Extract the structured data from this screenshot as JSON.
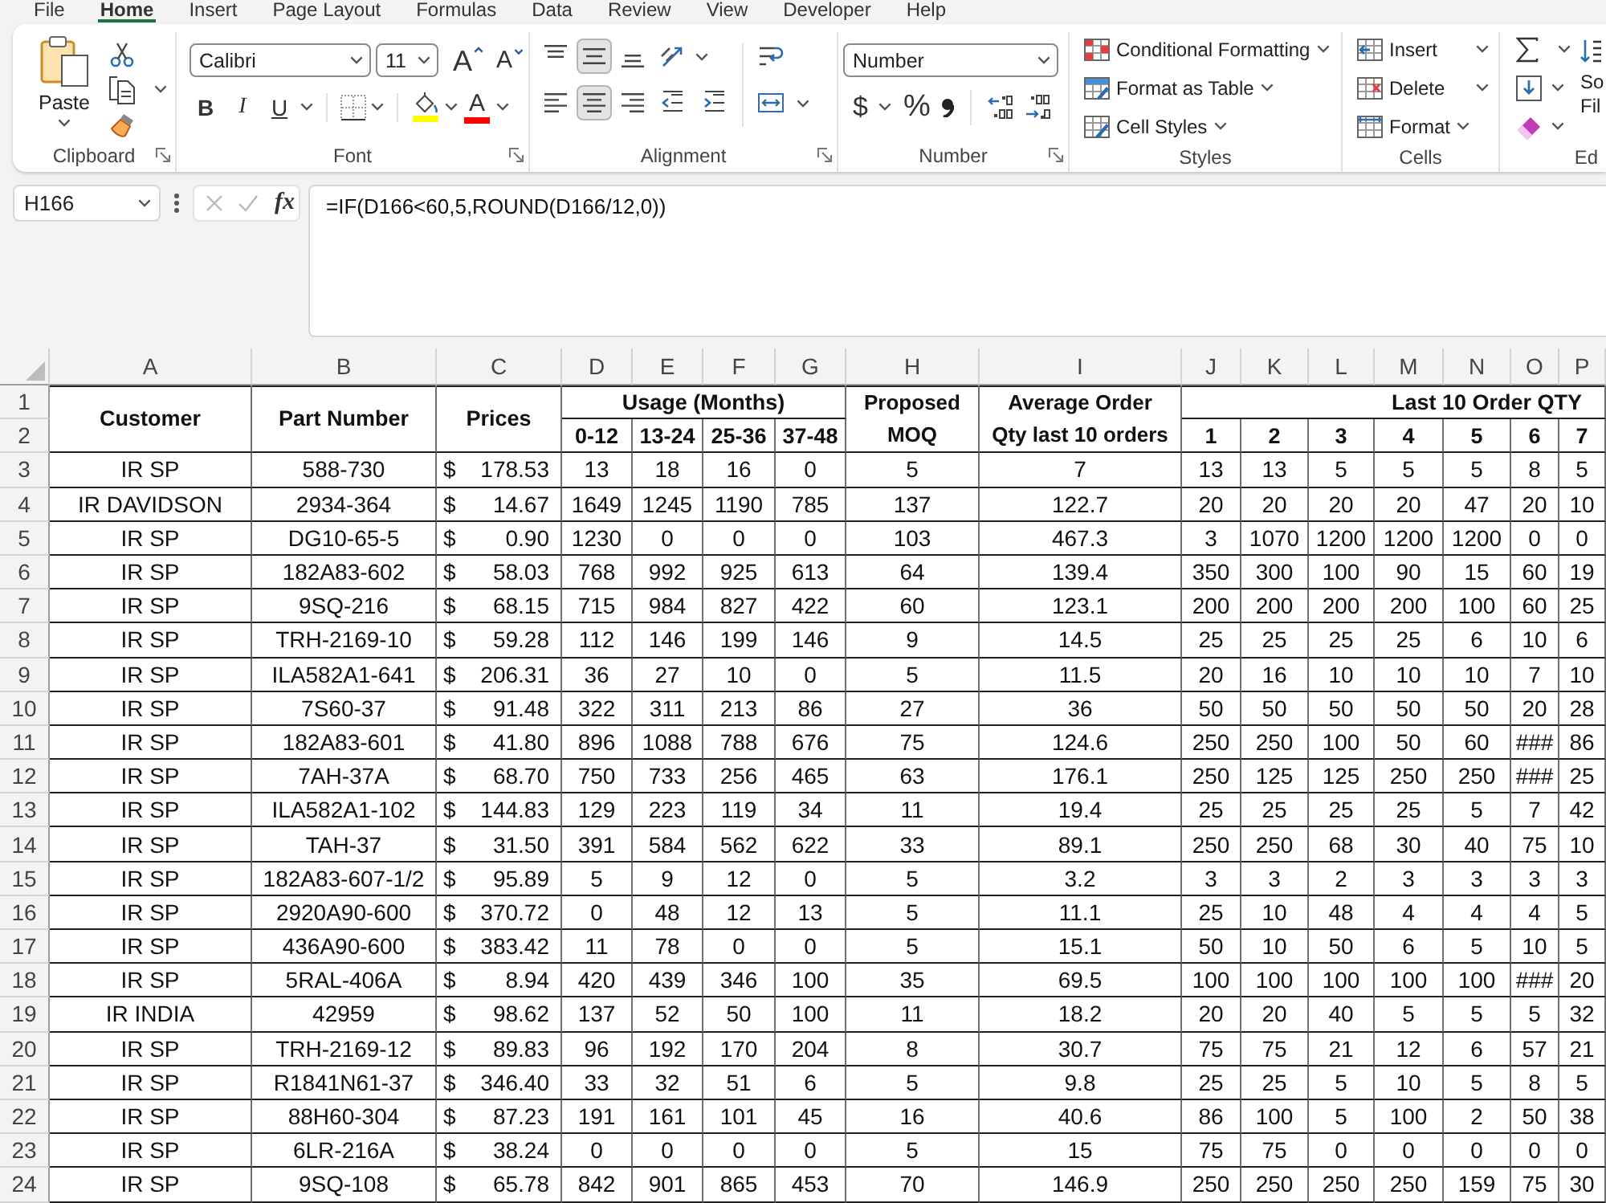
{
  "tabs": [
    {
      "label": "File",
      "selected": false
    },
    {
      "label": "Home",
      "selected": true
    },
    {
      "label": "Insert",
      "selected": false
    },
    {
      "label": "Page Layout",
      "selected": false
    },
    {
      "label": "Formulas",
      "selected": false
    },
    {
      "label": "Data",
      "selected": false
    },
    {
      "label": "Review",
      "selected": false
    },
    {
      "label": "View",
      "selected": false
    },
    {
      "label": "Developer",
      "selected": false
    },
    {
      "label": "Help",
      "selected": false
    }
  ],
  "ribbon": {
    "clipboard": {
      "paste_label": "Paste",
      "group_label": "Clipboard"
    },
    "font": {
      "font_name": "Calibri",
      "font_size": "11",
      "size_buttons": [
        {
          "kind": "grow",
          "label": "A"
        },
        {
          "kind": "shrink",
          "label": "A"
        }
      ],
      "style_buttons": [
        {
          "kind": "bold",
          "label": "B"
        },
        {
          "kind": "italic",
          "label": "I"
        },
        {
          "kind": "underline",
          "label": "U"
        }
      ],
      "color_buttons": [
        {
          "kind": "fill",
          "color": "#ffff00"
        },
        {
          "kind": "text",
          "label": "A",
          "color": "#ff0000"
        }
      ],
      "group_label": "Font"
    },
    "alignment": {
      "vertical": [
        {
          "kind": "top",
          "selected": false
        },
        {
          "kind": "middle",
          "selected": true
        },
        {
          "kind": "bottom",
          "selected": false
        }
      ],
      "horizontal": [
        {
          "kind": "left",
          "selected": false
        },
        {
          "kind": "center",
          "selected": true
        },
        {
          "kind": "right",
          "selected": false
        }
      ],
      "group_label": "Alignment"
    },
    "number": {
      "format": "Number",
      "buttons": [
        {
          "kind": "currency",
          "label": "$"
        },
        {
          "kind": "percent",
          "label": "%"
        }
      ],
      "group_label": "Number"
    },
    "styles": {
      "commands": [
        {
          "kind": "conditional",
          "label": "Conditional Formatting"
        },
        {
          "kind": "table",
          "label": "Format as Table"
        },
        {
          "kind": "cell-styles",
          "label": "Cell Styles"
        }
      ],
      "group_label": "Styles"
    },
    "cells": {
      "commands": [
        {
          "kind": "insert",
          "label": "Insert"
        },
        {
          "kind": "delete",
          "label": "Delete"
        },
        {
          "kind": "format",
          "label": "Format"
        }
      ],
      "group_label": "Cells"
    },
    "editing": {
      "sort_label_lines": [
        "So",
        "Fil"
      ],
      "group_label": "Ed"
    }
  },
  "formula_bar": {
    "name_box": "H166",
    "function_label": "fx",
    "formula": "=IF(D166<60,5,ROUND(D166/12,0))"
  },
  "sheet": {
    "column_letters": [
      "A",
      "B",
      "C",
      "D",
      "E",
      "F",
      "G",
      "H",
      "I",
      "J",
      "K",
      "L",
      "M",
      "N",
      "O",
      "P"
    ],
    "header": {
      "row_numbers": [
        "1",
        "2"
      ],
      "customer": "Customer",
      "part_number": "Part Number",
      "prices": "Prices",
      "usage_title": "Usage (Months)",
      "usage_ranges": [
        "0-12",
        "13-24",
        "25-36",
        "37-48"
      ],
      "proposed_moq": "Proposed MOQ",
      "average_order": "Average Order Qty last 10 orders",
      "last_orders_title": "Last 10 Order QTY",
      "order_numbers": [
        "1",
        "2",
        "3",
        "4",
        "5",
        "6",
        "7"
      ]
    },
    "rows": [
      {
        "row": "3",
        "customer": "IR SP",
        "part_number": "588-730",
        "currency": "$",
        "price": "178.53",
        "usage": [
          "13",
          "18",
          "16",
          "0"
        ],
        "proposed_moq": "5",
        "average_order": "7",
        "orders": [
          "13",
          "13",
          "5",
          "5",
          "5",
          "8",
          "5"
        ]
      },
      {
        "row": "4",
        "customer": "IR DAVIDSON",
        "part_number": "2934-364",
        "currency": "$",
        "price": "14.67",
        "usage": [
          "1649",
          "1245",
          "1190",
          "785"
        ],
        "proposed_moq": "137",
        "average_order": "122.7",
        "orders": [
          "20",
          "20",
          "20",
          "20",
          "47",
          "20",
          "10"
        ]
      },
      {
        "row": "5",
        "customer": "IR SP",
        "part_number": "DG10-65-5",
        "currency": "$",
        "price": "0.90",
        "usage": [
          "1230",
          "0",
          "0",
          "0"
        ],
        "proposed_moq": "103",
        "average_order": "467.3",
        "orders": [
          "3",
          "1070",
          "1200",
          "1200",
          "1200",
          "0",
          "0"
        ]
      },
      {
        "row": "6",
        "customer": "IR SP",
        "part_number": "182A83-602",
        "currency": "$",
        "price": "58.03",
        "usage": [
          "768",
          "992",
          "925",
          "613"
        ],
        "proposed_moq": "64",
        "average_order": "139.4",
        "orders": [
          "350",
          "300",
          "100",
          "90",
          "15",
          "60",
          "19"
        ]
      },
      {
        "row": "7",
        "customer": "IR SP",
        "part_number": "9SQ-216",
        "currency": "$",
        "price": "68.15",
        "usage": [
          "715",
          "984",
          "827",
          "422"
        ],
        "proposed_moq": "60",
        "average_order": "123.1",
        "orders": [
          "200",
          "200",
          "200",
          "200",
          "100",
          "60",
          "25"
        ]
      },
      {
        "row": "8",
        "customer": "IR SP",
        "part_number": "TRH-2169-10",
        "currency": "$",
        "price": "59.28",
        "usage": [
          "112",
          "146",
          "199",
          "146"
        ],
        "proposed_moq": "9",
        "average_order": "14.5",
        "orders": [
          "25",
          "25",
          "25",
          "25",
          "6",
          "10",
          "6"
        ]
      },
      {
        "row": "9",
        "customer": "IR SP",
        "part_number": "ILA582A1-641",
        "currency": "$",
        "price": "206.31",
        "usage": [
          "36",
          "27",
          "10",
          "0"
        ],
        "proposed_moq": "5",
        "average_order": "11.5",
        "orders": [
          "20",
          "16",
          "10",
          "10",
          "10",
          "7",
          "10"
        ]
      },
      {
        "row": "10",
        "customer": "IR SP",
        "part_number": "7S60-37",
        "currency": "$",
        "price": "91.48",
        "usage": [
          "322",
          "311",
          "213",
          "86"
        ],
        "proposed_moq": "27",
        "average_order": "36",
        "orders": [
          "50",
          "50",
          "50",
          "50",
          "50",
          "20",
          "28"
        ]
      },
      {
        "row": "11",
        "customer": "IR SP",
        "part_number": "182A83-601",
        "currency": "$",
        "price": "41.80",
        "usage": [
          "896",
          "1088",
          "788",
          "676"
        ],
        "proposed_moq": "75",
        "average_order": "124.6",
        "orders": [
          "250",
          "250",
          "100",
          "50",
          "60",
          "###",
          "86"
        ]
      },
      {
        "row": "12",
        "customer": "IR SP",
        "part_number": "7AH-37A",
        "currency": "$",
        "price": "68.70",
        "usage": [
          "750",
          "733",
          "256",
          "465"
        ],
        "proposed_moq": "63",
        "average_order": "176.1",
        "orders": [
          "250",
          "125",
          "125",
          "250",
          "250",
          "###",
          "25"
        ]
      },
      {
        "row": "13",
        "customer": "IR SP",
        "part_number": "ILA582A1-102",
        "currency": "$",
        "price": "144.83",
        "usage": [
          "129",
          "223",
          "119",
          "34"
        ],
        "proposed_moq": "11",
        "average_order": "19.4",
        "orders": [
          "25",
          "25",
          "25",
          "25",
          "5",
          "7",
          "42"
        ]
      },
      {
        "row": "14",
        "customer": "IR SP",
        "part_number": "TAH-37",
        "currency": "$",
        "price": "31.50",
        "usage": [
          "391",
          "584",
          "562",
          "622"
        ],
        "proposed_moq": "33",
        "average_order": "89.1",
        "orders": [
          "250",
          "250",
          "68",
          "30",
          "40",
          "75",
          "10"
        ]
      },
      {
        "row": "15",
        "customer": "IR SP",
        "part_number": "182A83-607-1/2",
        "currency": "$",
        "price": "95.89",
        "usage": [
          "5",
          "9",
          "12",
          "0"
        ],
        "proposed_moq": "5",
        "average_order": "3.2",
        "orders": [
          "3",
          "3",
          "2",
          "3",
          "3",
          "3",
          "3"
        ]
      },
      {
        "row": "16",
        "customer": "IR SP",
        "part_number": "2920A90-600",
        "currency": "$",
        "price": "370.72",
        "usage": [
          "0",
          "48",
          "12",
          "13"
        ],
        "proposed_moq": "5",
        "average_order": "11.1",
        "orders": [
          "25",
          "10",
          "48",
          "4",
          "4",
          "4",
          "5"
        ]
      },
      {
        "row": "17",
        "customer": "IR SP",
        "part_number": "436A90-600",
        "currency": "$",
        "price": "383.42",
        "usage": [
          "11",
          "78",
          "0",
          "0"
        ],
        "proposed_moq": "5",
        "average_order": "15.1",
        "orders": [
          "50",
          "10",
          "50",
          "6",
          "5",
          "10",
          "5"
        ]
      },
      {
        "row": "18",
        "customer": "IR SP",
        "part_number": "5RAL-406A",
        "currency": "$",
        "price": "8.94",
        "usage": [
          "420",
          "439",
          "346",
          "100"
        ],
        "proposed_moq": "35",
        "average_order": "69.5",
        "orders": [
          "100",
          "100",
          "100",
          "100",
          "100",
          "###",
          "20"
        ]
      },
      {
        "row": "19",
        "customer": "IR INDIA",
        "part_number": "42959",
        "currency": "$",
        "price": "98.62",
        "usage": [
          "137",
          "52",
          "50",
          "100"
        ],
        "proposed_moq": "11",
        "average_order": "18.2",
        "orders": [
          "20",
          "20",
          "40",
          "5",
          "5",
          "5",
          "32"
        ]
      },
      {
        "row": "20",
        "customer": "IR SP",
        "part_number": "TRH-2169-12",
        "currency": "$",
        "price": "89.83",
        "usage": [
          "96",
          "192",
          "170",
          "204"
        ],
        "proposed_moq": "8",
        "average_order": "30.7",
        "orders": [
          "75",
          "75",
          "21",
          "12",
          "6",
          "57",
          "21"
        ]
      },
      {
        "row": "21",
        "customer": "IR SP",
        "part_number": "R1841N61-37",
        "currency": "$",
        "price": "346.40",
        "usage": [
          "33",
          "32",
          "51",
          "6"
        ],
        "proposed_moq": "5",
        "average_order": "9.8",
        "orders": [
          "25",
          "25",
          "5",
          "10",
          "5",
          "8",
          "5"
        ]
      },
      {
        "row": "22",
        "customer": "IR SP",
        "part_number": "88H60-304",
        "currency": "$",
        "price": "87.23",
        "usage": [
          "191",
          "161",
          "101",
          "45"
        ],
        "proposed_moq": "16",
        "average_order": "40.6",
        "orders": [
          "86",
          "100",
          "5",
          "100",
          "2",
          "50",
          "38"
        ]
      },
      {
        "row": "23",
        "customer": "IR SP",
        "part_number": "6LR-216A",
        "currency": "$",
        "price": "38.24",
        "usage": [
          "0",
          "0",
          "0",
          "0"
        ],
        "proposed_moq": "5",
        "average_order": "15",
        "orders": [
          "75",
          "75",
          "0",
          "0",
          "0",
          "0",
          "0"
        ]
      },
      {
        "row": "24",
        "customer": "IR SP",
        "part_number": "9SQ-108",
        "currency": "$",
        "price": "65.78",
        "usage": [
          "842",
          "901",
          "865",
          "453"
        ],
        "proposed_moq": "70",
        "average_order": "146.9",
        "orders": [
          "250",
          "250",
          "250",
          "250",
          "159",
          "75",
          "30"
        ]
      }
    ]
  }
}
